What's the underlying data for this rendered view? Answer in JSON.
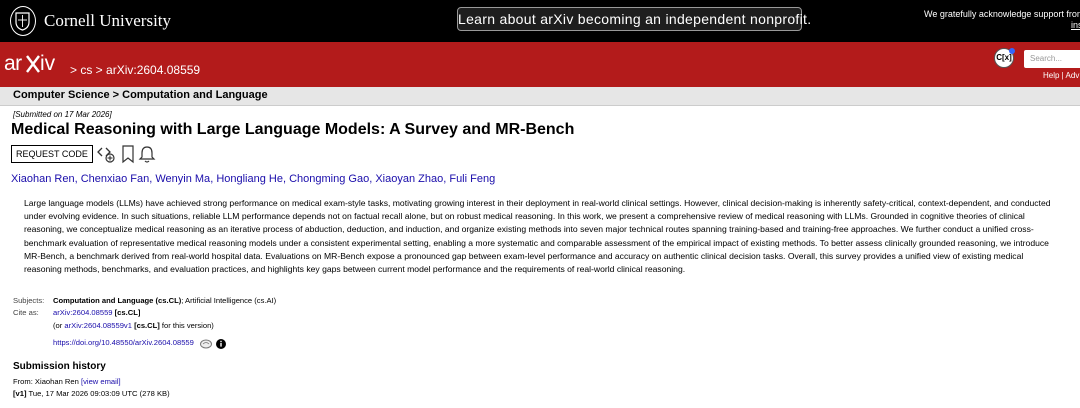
{
  "topbar": {
    "institution": "Cornell University",
    "announcement": "Learn about arXiv becoming an independent nonprofit.",
    "acknowledgement": "We gratefully acknowledge support from the",
    "acknowledgement_link": "ins"
  },
  "header": {
    "crumb_cs": "cs",
    "crumb_sep1": " > ",
    "crumb_sep0": " > ",
    "crumb_id": "arXiv:2604.08559",
    "search_placeholder": "Search...",
    "help_links": "Help | Adv"
  },
  "subject_band": "Computer Science > Computation and Language",
  "paper": {
    "submitted": "[Submitted on 17 Mar 2026]",
    "title": "Medical Reasoning with Large Language Models: A Survey and MR-Bench",
    "request_code": "REQUEST CODE",
    "authors": [
      "Xiaohan Ren",
      "Chenxiao Fan",
      "Wenyin Ma",
      "Hongliang He",
      "Chongming Gao",
      "Xiaoyan Zhao",
      "Fuli Feng"
    ],
    "abstract": "Large language models (LLMs) have achieved strong performance on medical exam-style tasks, motivating growing interest in their deployment in real-world clinical settings. However, clinical decision-making is inherently safety-critical, context-dependent, and conducted under evolving evidence. In such situations, reliable LLM performance depends not on factual recall alone, but on robust medical reasoning. In this work, we present a comprehensive review of medical reasoning with LLMs. Grounded in cognitive theories of clinical reasoning, we conceptualize medical reasoning as an iterative process of abduction, deduction, and induction, and organize existing methods into seven major technical routes spanning training-based and training-free approaches. We further conduct a unified cross-benchmark evaluation of representative medical reasoning models under a consistent experimental setting, enabling a more systematic and comparable assessment of the empirical impact of existing methods. To better assess clinically grounded reasoning, we introduce MR-Bench, a benchmark derived from real-world hospital data. Evaluations on MR-Bench expose a pronounced gap between exam-level performance and accuracy on authentic clinical decision tasks. Overall, this survey provides a unified view of existing medical reasoning methods, benchmarks, and evaluation practices, and highlights key gaps between current model performance and the requirements of real-world clinical reasoning."
  },
  "metadata": {
    "subjects_label": "Subjects:",
    "subjects_primary": "Computation and Language (cs.CL)",
    "subjects_rest": "; Artificial Intelligence (cs.AI)",
    "cite_label": "Cite as:",
    "cite_id": "arXiv:2604.08559",
    "cite_cat": " [cs.CL]",
    "version_prefix": "(or ",
    "version_id": "arXiv:2604.08559v1",
    "version_cat": " [cs.CL]",
    "version_suffix": " for this version)",
    "doi": "https://doi.org/10.48550/arXiv.2604.08559"
  },
  "history": {
    "heading": "Submission history",
    "from_prefix": "From: Xiaohan Ren ",
    "view_email": "[view email]",
    "v1_label": "[v1]",
    "v1_text": " Tue, 17 Mar 2026 09:03:09 UTC (278 KB)"
  }
}
